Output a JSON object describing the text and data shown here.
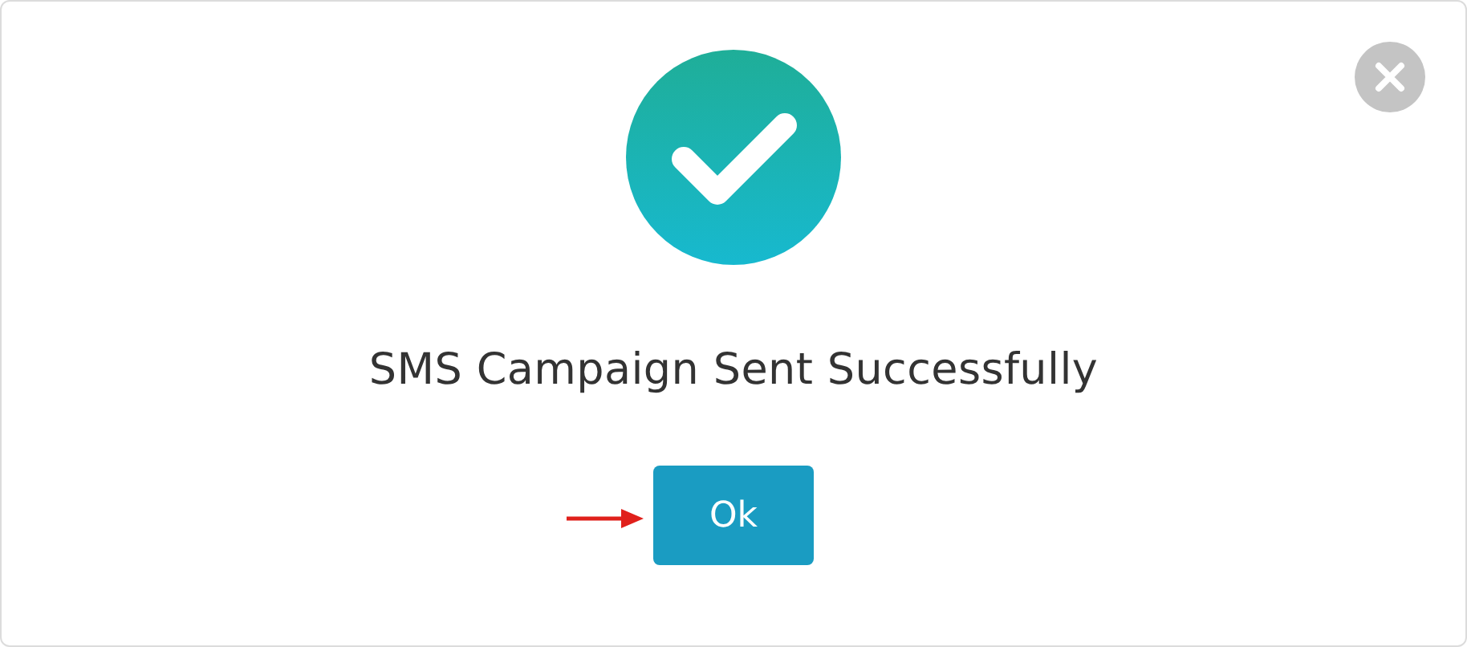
{
  "dialog": {
    "message": "SMS Campaign Sent Successfully",
    "button": "Ok"
  }
}
